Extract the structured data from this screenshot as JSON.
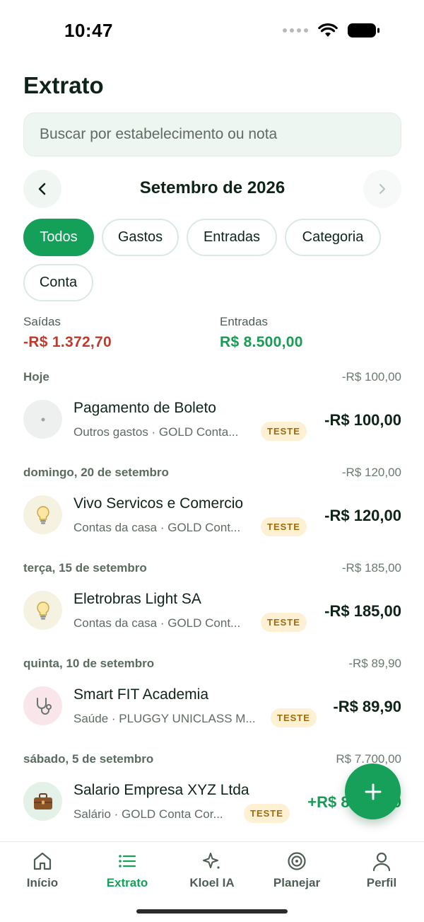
{
  "status_bar": {
    "time": "10:47"
  },
  "title": "Extrato",
  "search": {
    "placeholder": "Buscar por estabelecimento ou nota",
    "value": ""
  },
  "month_nav": {
    "label": "Setembro de 2026"
  },
  "filters": [
    {
      "label": "Todos",
      "active": true
    },
    {
      "label": "Gastos",
      "active": false
    },
    {
      "label": "Entradas",
      "active": false
    },
    {
      "label": "Categoria",
      "active": false
    },
    {
      "label": "Conta",
      "active": false
    }
  ],
  "totals": {
    "outflow_label": "Saídas",
    "outflow_value": "-R$ 1.372,70",
    "inflow_label": "Entradas",
    "inflow_value": "R$ 8.500,00"
  },
  "groups": [
    {
      "day": "Hoje",
      "total": "-R$ 100,00",
      "tx": {
        "name": "Pagamento de Boleto",
        "meta": "Outros gastos · GOLD Conta...",
        "badge": "TESTE",
        "amount": "-R$ 100,00",
        "icon": "dot-icon"
      }
    },
    {
      "day": "domingo, 20 de setembro",
      "total": "-R$ 120,00",
      "tx": {
        "name": "Vivo Servicos e Comercio",
        "meta": "Contas da casa · GOLD Cont...",
        "badge": "TESTE",
        "amount": "-R$ 120,00",
        "icon": "lightbulb-icon"
      }
    },
    {
      "day": "terça, 15 de setembro",
      "total": "-R$ 185,00",
      "tx": {
        "name": "Eletrobras Light SA",
        "meta": "Contas da casa · GOLD Cont...",
        "badge": "TESTE",
        "amount": "-R$ 185,00",
        "icon": "lightbulb-icon"
      }
    },
    {
      "day": "quinta, 10 de setembro",
      "total": "-R$ 89,90",
      "tx": {
        "name": "Smart FIT Academia",
        "meta": "Saúde · PLUGGY UNICLASS M...",
        "badge": "TESTE",
        "amount": "-R$ 89,90",
        "icon": "stethoscope-icon"
      }
    },
    {
      "day": "sábado, 5 de setembro",
      "total": "R$ 7.700,00",
      "tx": {
        "name": "Salario Empresa XYZ Ltda",
        "meta": "Salário · GOLD Conta Cor...",
        "badge": "TESTE",
        "amount": "+R$ 8.500,00",
        "icon": "briefcase-icon"
      }
    }
  ],
  "fab": {
    "icon": "plus-icon"
  },
  "tab_bar": [
    {
      "label": "Início",
      "icon": "home-icon",
      "active": false
    },
    {
      "label": "Extrato",
      "icon": "list-icon",
      "active": true
    },
    {
      "label": "Kloel IA",
      "icon": "sparkle-icon",
      "active": false
    },
    {
      "label": "Planejar",
      "icon": "target-icon",
      "active": false
    },
    {
      "label": "Perfil",
      "icon": "user-icon",
      "active": false
    }
  ],
  "colors": {
    "accent": "#16a05a",
    "negative": "#c0392b",
    "badge_bg": "#fdf0d3",
    "badge_text": "#a06a0b"
  }
}
